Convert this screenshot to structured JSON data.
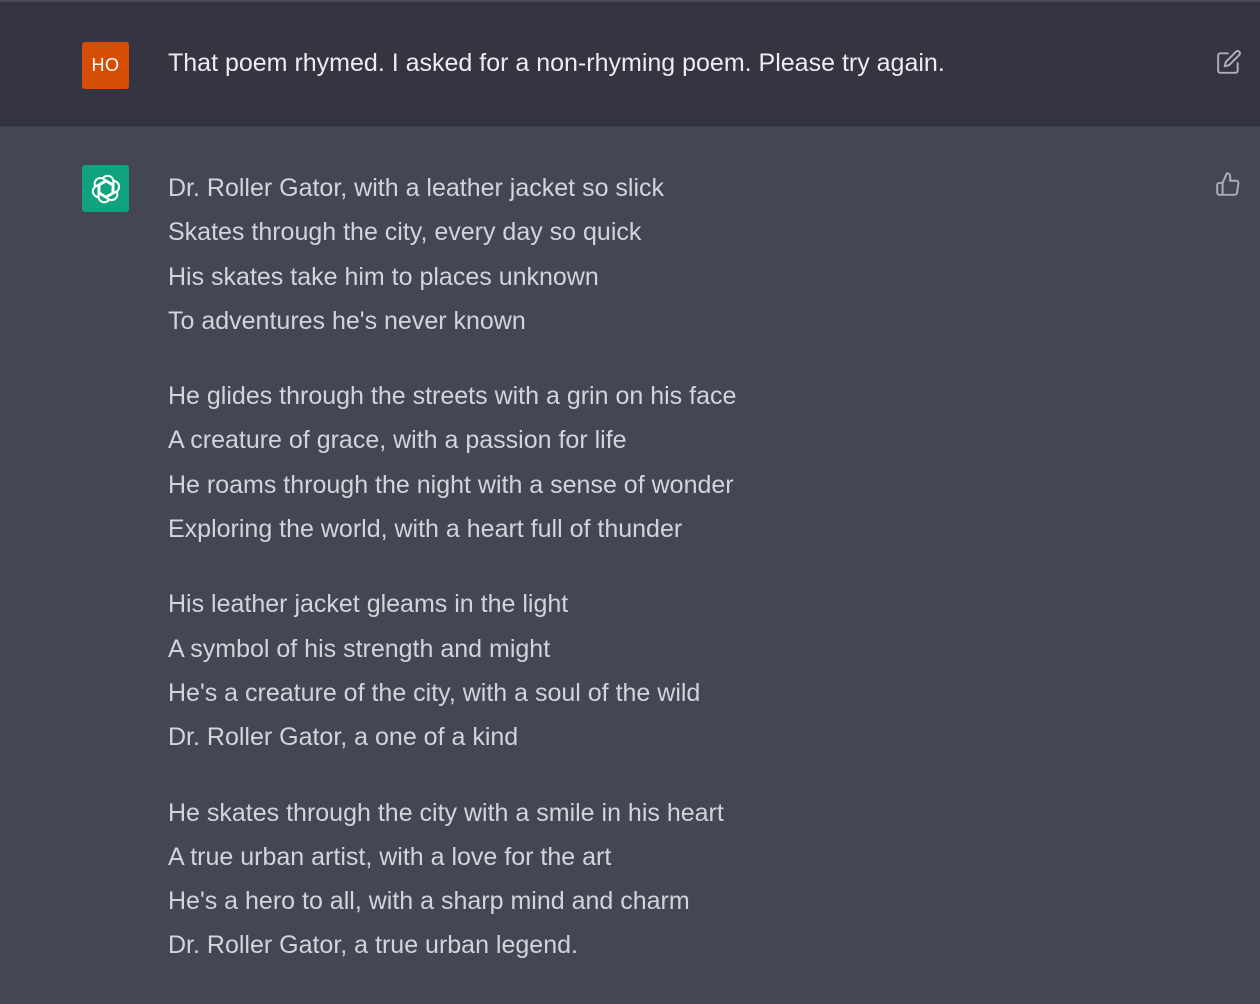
{
  "user_message": {
    "avatar_initials": "HO",
    "text": "That poem rhymed. I asked for a non-rhyming poem. Please try again."
  },
  "assistant_message": {
    "stanzas": [
      {
        "lines": [
          "Dr. Roller Gator, with a leather jacket so slick",
          "Skates through the city, every day so quick",
          "His skates take him to places unknown",
          "To adventures he's never known"
        ]
      },
      {
        "lines": [
          "He glides through the streets with a grin on his face",
          "A creature of grace, with a passion for life",
          "He roams through the night with a sense of wonder",
          "Exploring the world, with a heart full of thunder"
        ]
      },
      {
        "lines": [
          "His leather jacket gleams in the light",
          "A symbol of his strength and might",
          "He's a creature of the city, with a soul of the wild",
          "Dr. Roller Gator, a one of a kind"
        ]
      },
      {
        "lines": [
          "He skates through the city with a smile in his heart",
          "A true urban artist, with a love for the art",
          "He's a hero to all, with a sharp mind and charm",
          "Dr. Roller Gator, a true urban legend."
        ]
      }
    ]
  },
  "icons": {
    "edit": "edit-icon",
    "thumbs_up": "thumbs-up-icon",
    "assistant_logo": "openai-logo-icon"
  },
  "colors": {
    "user_bg": "#343541",
    "assistant_bg": "#444654",
    "user_avatar": "#d64d04",
    "assistant_avatar": "#10a37f"
  }
}
